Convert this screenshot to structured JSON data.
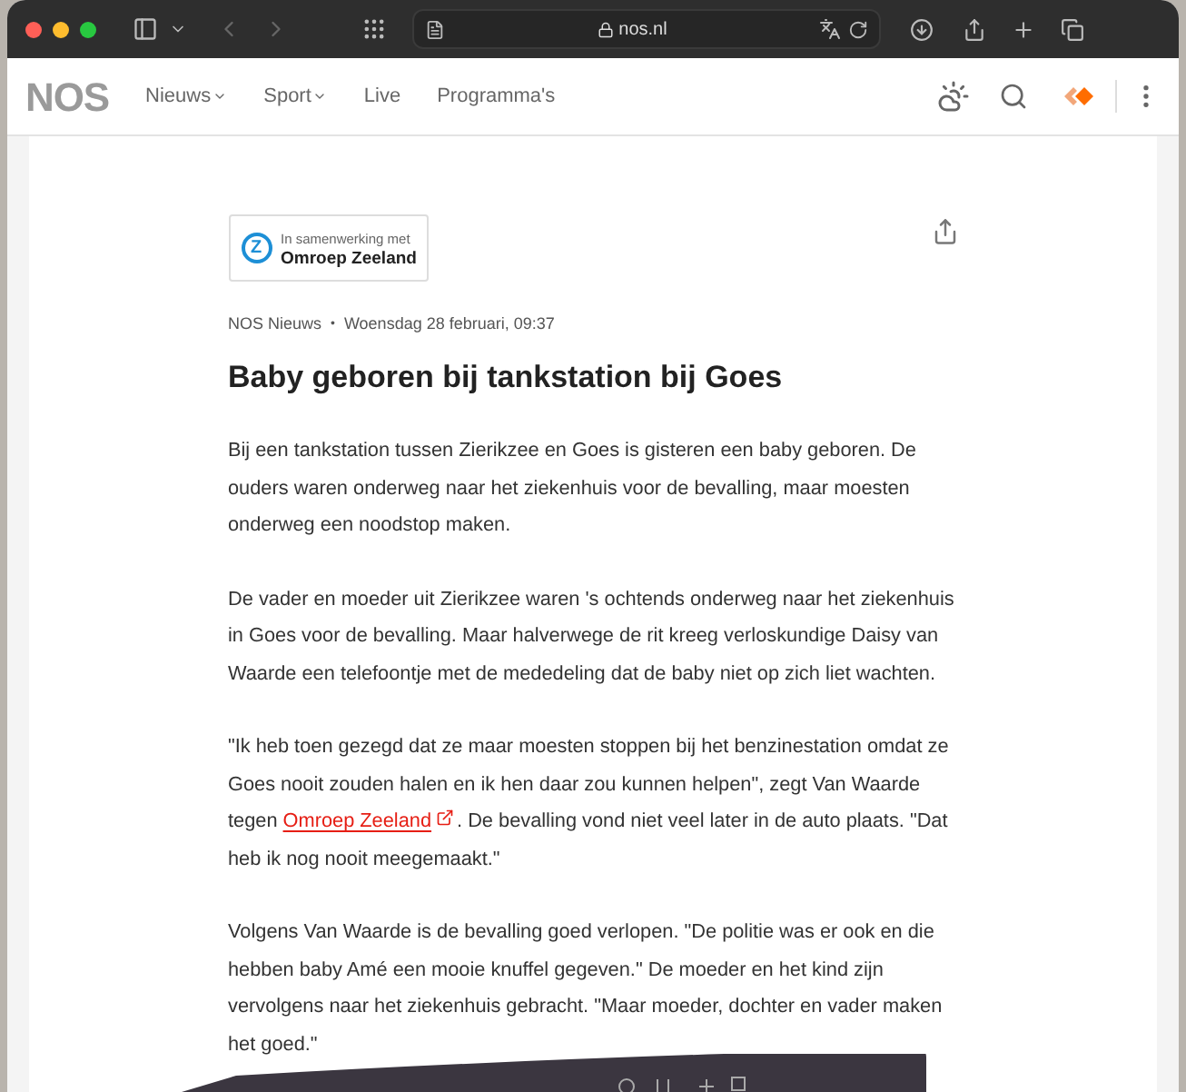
{
  "browser": {
    "address": "nos.nl"
  },
  "nav": {
    "logo": "NOS",
    "items": [
      {
        "label": "Nieuws",
        "dropdown": true
      },
      {
        "label": "Sport",
        "dropdown": true
      },
      {
        "label": "Live",
        "dropdown": false
      },
      {
        "label": "Programma's",
        "dropdown": false
      }
    ]
  },
  "partner": {
    "caption": "In samenwerking met",
    "name": "Omroep Zeeland",
    "letter": "Z"
  },
  "article": {
    "source": "NOS Nieuws",
    "separator": "•",
    "date": "Woensdag 28 februari, 09:37",
    "title": "Baby geboren bij tankstation bij Goes",
    "paragraphs": [
      {
        "kind": "text",
        "text": "Bij een tankstation tussen Zierikzee en Goes is gisteren een baby geboren. De ouders waren onderweg naar het ziekenhuis voor de bevalling, maar moesten onderweg een noodstop maken."
      },
      {
        "kind": "text",
        "text": "De vader en moeder uit Zierikzee waren 's ochtends onderweg naar het ziekenhuis in Goes voor de bevalling. Maar halverwege de rit kreeg verloskundige Daisy van Waarde een telefoontje met de mededeling dat de baby niet op zich liet wachten."
      },
      {
        "kind": "link",
        "before": "\"Ik heb toen gezegd dat ze maar moesten stoppen bij het benzinestation omdat ze Goes nooit zouden halen en ik hen daar zou kunnen helpen\", zegt Van Waarde tegen ",
        "link": "Omroep Zeeland",
        "after": ". De bevalling vond niet veel later in de auto plaats. \"Dat heb ik nog nooit meegemaakt.\""
      },
      {
        "kind": "text",
        "text": "Volgens Van Waarde is de bevalling goed verlopen. \"De politie was er ook en die hebben baby Amé een mooie knuffel gegeven.\" De moeder en het kind zijn vervolgens naar het ziekenhuis gebracht. \"Maar moeder, dochter en vader maken het goed.\""
      }
    ]
  }
}
